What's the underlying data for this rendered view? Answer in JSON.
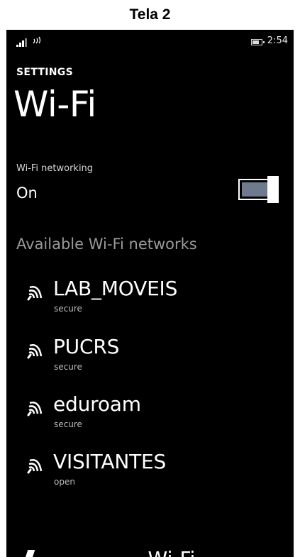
{
  "caption": "Tela 2",
  "status_bar": {
    "time": "2:54"
  },
  "header": {
    "section": "SETTINGS",
    "title": "Wi-Fi"
  },
  "wifi_toggle": {
    "label": "Wi-Fi networking",
    "state": "On",
    "accent_color": "#6f7a8e"
  },
  "networks_section": {
    "heading": "Available Wi-Fi networks"
  },
  "networks": [
    {
      "name": "LAB_MOVEIS",
      "status": "secure"
    },
    {
      "name": "PUCRS",
      "status": "secure"
    },
    {
      "name": "eduroam",
      "status": "secure"
    },
    {
      "name": "VISITANTES",
      "status": "open"
    }
  ],
  "partial_row": {
    "text": "........ ..... Wi-Fi"
  }
}
